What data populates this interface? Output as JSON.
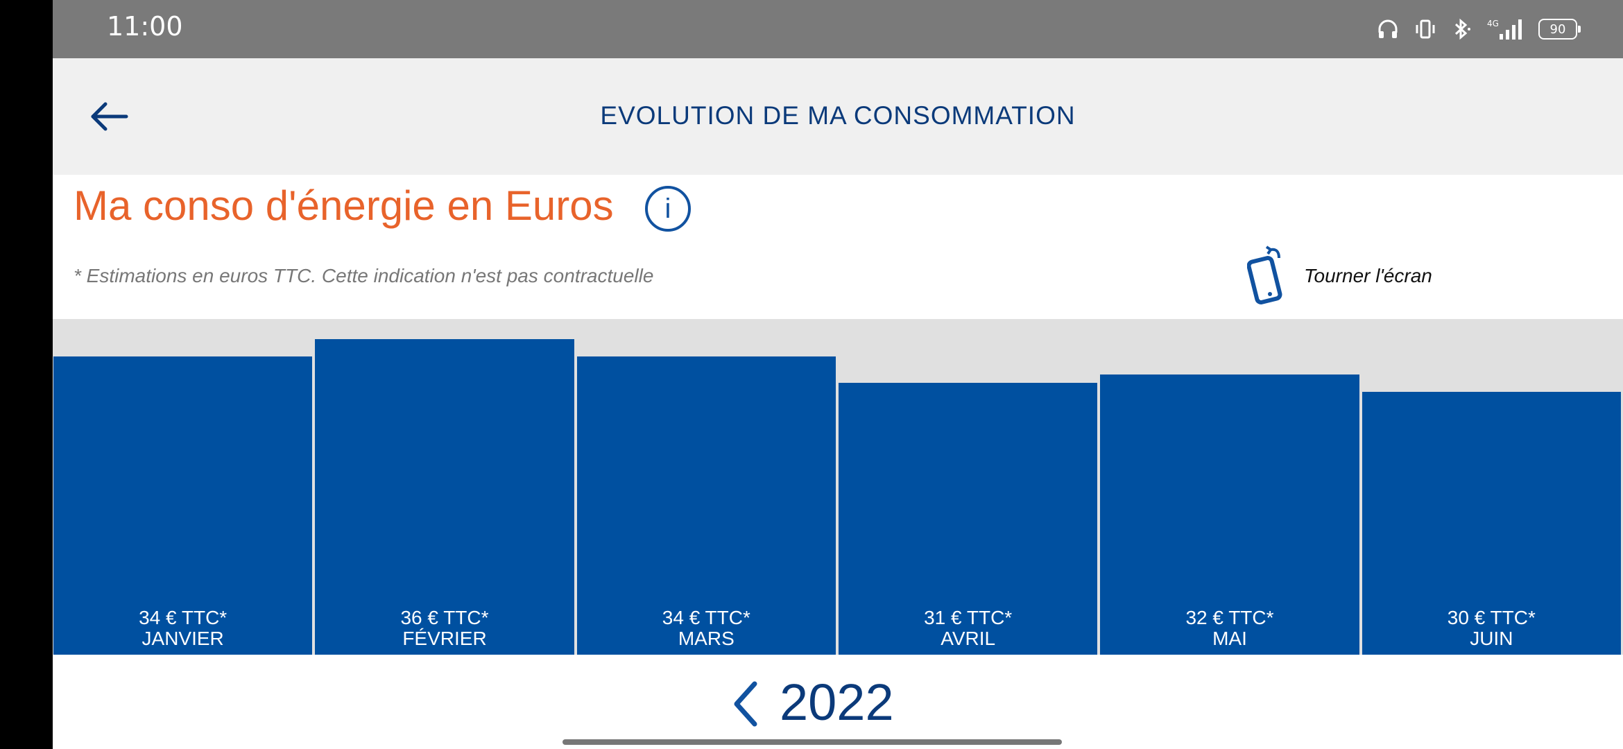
{
  "status_bar": {
    "time": "11:00",
    "battery": "90",
    "icons": [
      "headphones-icon",
      "vibrate-icon",
      "bluetooth-icon",
      "signal-4g-icon",
      "battery-icon"
    ]
  },
  "header": {
    "title": "EVOLUTION DE MA CONSOMMATION",
    "back_icon": "back-arrow-icon"
  },
  "section": {
    "title": "Ma conso d'énergie en Euros",
    "info_glyph": "i",
    "disclaimer": "* Estimations en euros TTC. Cette indication n'est pas contractuelle",
    "rotate_label": "Tourner l'écran"
  },
  "colors": {
    "accent_orange": "#e8632b",
    "bar_blue": "#0050a0",
    "navy": "#0b3a7a",
    "chart_bg": "#e0e0e0"
  },
  "chart_data": {
    "type": "bar",
    "categories": [
      "JANVIER",
      "FÉVRIER",
      "MARS",
      "AVRIL",
      "MAI",
      "JUIN"
    ],
    "values": [
      34,
      36,
      34,
      31,
      32,
      30
    ],
    "value_labels": [
      "34 € TTC*",
      "36 € TTC*",
      "34 € TTC*",
      "31 € TTC*",
      "32 € TTC*",
      "30 € TTC*"
    ],
    "title": "",
    "xlabel": "",
    "ylabel": "",
    "grid": false
  },
  "year_nav": {
    "year": "2022"
  }
}
